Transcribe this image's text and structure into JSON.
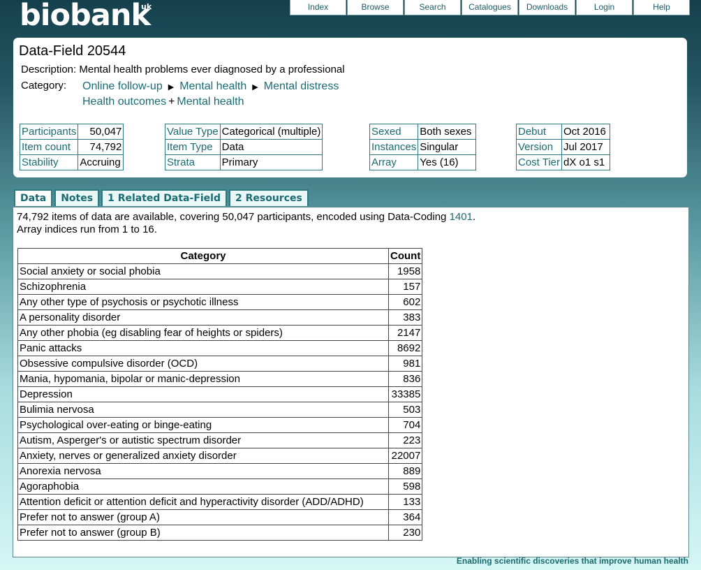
{
  "header": {
    "logo": "biobank",
    "logo_suffix": "uk",
    "nav": [
      "Index",
      "Browse",
      "Search",
      "Catalogues",
      "Downloads",
      "Login",
      "Help"
    ]
  },
  "field": {
    "title": "Data-Field 20544",
    "description_label": "Description:",
    "description": "Mental health problems ever diagnosed by a professional",
    "category_label": "Category:",
    "category_path_1": [
      "Online follow-up",
      "Mental health",
      "Mental distress"
    ],
    "category_path_2": [
      "Health outcomes",
      "Mental health"
    ]
  },
  "stats": {
    "group1": [
      [
        "Participants",
        "50,047"
      ],
      [
        "Item count",
        "74,792"
      ],
      [
        "Stability",
        "Accruing"
      ]
    ],
    "group2": [
      [
        "Value Type",
        "Categorical (multiple)"
      ],
      [
        "Item Type",
        "Data"
      ],
      [
        "Strata",
        "Primary"
      ]
    ],
    "group3": [
      [
        "Sexed",
        "Both sexes"
      ],
      [
        "Instances",
        "Singular"
      ],
      [
        "Array",
        "Yes (16)"
      ]
    ],
    "group4": [
      [
        "Debut",
        "Oct 2016"
      ],
      [
        "Version",
        "Jul 2017"
      ],
      [
        "Cost Tier",
        "dX o1 s1"
      ]
    ]
  },
  "tabs": [
    "Data",
    "Notes",
    "1 Related Data-Field",
    "2 Resources"
  ],
  "summary": {
    "line1_pre": "74,792 items of data are available, covering 50,047 participants, encoded using Data-Coding",
    "coding": "1401",
    "line1_post": ".",
    "line2": "Array indices run from 1 to 16."
  },
  "table": {
    "headers": [
      "Category",
      "Count"
    ],
    "rows": [
      [
        "Social anxiety or social phobia",
        "1958"
      ],
      [
        "Schizophrenia",
        "157"
      ],
      [
        "Any other type of psychosis or psychotic illness",
        "602"
      ],
      [
        "A personality disorder",
        "383"
      ],
      [
        "Any other phobia (eg disabling fear of heights or spiders)",
        "2147"
      ],
      [
        "Panic attacks",
        "8692"
      ],
      [
        "Obsessive compulsive disorder (OCD)",
        "981"
      ],
      [
        "Mania, hypomania, bipolar or manic-depression",
        "836"
      ],
      [
        "Depression",
        "33385"
      ],
      [
        "Bulimia nervosa",
        "503"
      ],
      [
        "Psychological over-eating or binge-eating",
        "704"
      ],
      [
        "Autism, Asperger's or autistic spectrum disorder",
        "223"
      ],
      [
        "Anxiety, nerves or generalized anxiety disorder",
        "22007"
      ],
      [
        "Anorexia nervosa",
        "889"
      ],
      [
        "Agoraphobia",
        "598"
      ],
      [
        "Attention deficit or attention deficit and hyperactivity disorder (ADD/ADHD)",
        "133"
      ],
      [
        "Prefer not to answer (group A)",
        "364"
      ],
      [
        "Prefer not to answer (group B)",
        "230"
      ]
    ]
  },
  "footer": "Enabling scientific discoveries that improve human health"
}
